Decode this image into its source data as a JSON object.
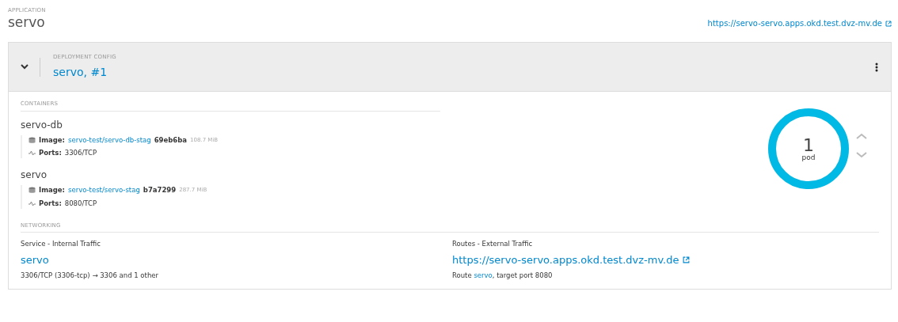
{
  "application": {
    "label": "APPLICATION",
    "name": "servo",
    "url": "https://servo-servo.apps.okd.test.dvz-mv.de"
  },
  "deployment": {
    "expanded": true,
    "label": "DEPLOYMENT CONFIG",
    "name": "servo, #1"
  },
  "containers": {
    "heading": "CONTAINERS",
    "items": [
      {
        "name": "servo-db",
        "image_label": "Image:",
        "image": "servo-test/servo-db-stag",
        "hash": "69eb6ba",
        "size": "108.7 MiB",
        "ports_label": "Ports:",
        "ports": "3306/TCP"
      },
      {
        "name": "servo",
        "image_label": "Image:",
        "image": "servo-test/servo-stag",
        "hash": "b7a7299",
        "size": "287.7 MiB",
        "ports_label": "Ports:",
        "ports": "8080/TCP"
      }
    ]
  },
  "pods": {
    "count": "1",
    "unit": "pod",
    "level": 1
  },
  "networking": {
    "heading": "NETWORKING",
    "service": {
      "label": "Service - Internal Traffic",
      "name": "servo",
      "detail": "3306/TCP (3306-tcp) → 3306 and 1 other"
    },
    "routes": {
      "label": "Routes - External Traffic",
      "url": "https://servo-servo.apps.okd.test.dvz-mv.de",
      "detail_prefix": "Route ",
      "detail_link": "servo",
      "detail_suffix": ", target port 8080"
    }
  }
}
